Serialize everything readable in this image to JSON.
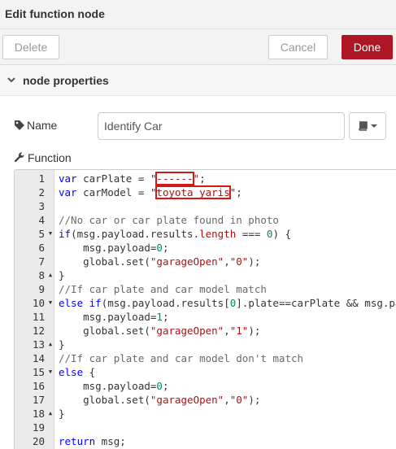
{
  "dialog": {
    "title": "Edit function node"
  },
  "toolbar": {
    "delete_label": "Delete",
    "cancel_label": "Cancel",
    "done_label": "Done"
  },
  "section": {
    "label": "node properties"
  },
  "name_field": {
    "label": "Name",
    "value": "Identify Car"
  },
  "function_field": {
    "label": "Function"
  },
  "colors": {
    "accent": "#ad1625",
    "highlight_box": "#d51717",
    "keyword": "#0000ff",
    "string": "#a31515",
    "number": "#09885a"
  },
  "icons": [
    "chevron-down-icon",
    "tag-icon",
    "book-icon",
    "caret-down-icon",
    "wrench-icon"
  ],
  "code_lines": [
    {
      "n": "1",
      "fold": "",
      "tokens": [
        [
          "kw",
          "var"
        ],
        [
          "",
          " carPlate = "
        ],
        [
          "str",
          "\""
        ],
        [
          "str hl",
          "------"
        ],
        [
          "str",
          "\""
        ],
        [
          "",
          ";"
        ]
      ]
    },
    {
      "n": "2",
      "fold": "",
      "tokens": [
        [
          "kw",
          "var"
        ],
        [
          "",
          " carModel = "
        ],
        [
          "str",
          "\""
        ],
        [
          "str hl",
          "toyota_yaris"
        ],
        [
          "str",
          "\""
        ],
        [
          "",
          ";"
        ]
      ]
    },
    {
      "n": "3",
      "fold": "",
      "tokens": []
    },
    {
      "n": "4",
      "fold": "",
      "tokens": [
        [
          "com",
          "//No car or car plate found in photo"
        ]
      ]
    },
    {
      "n": "5",
      "fold": "▼",
      "tokens": [
        [
          "kw",
          "if"
        ],
        [
          "",
          "(msg.payload.results."
        ],
        [
          "prop",
          "length"
        ],
        [
          "",
          " === "
        ],
        [
          "num",
          "0"
        ],
        [
          "",
          ") {"
        ]
      ]
    },
    {
      "n": "6",
      "fold": "",
      "tokens": [
        [
          "",
          "    msg.payload="
        ],
        [
          "num",
          "0"
        ],
        [
          "",
          ";"
        ]
      ]
    },
    {
      "n": "7",
      "fold": "",
      "tokens": [
        [
          "",
          "    global.set("
        ],
        [
          "str",
          "\"garageOpen\""
        ],
        [
          "",
          ","
        ],
        [
          "str",
          "\"0\""
        ],
        [
          "",
          ");"
        ]
      ]
    },
    {
      "n": "8",
      "fold": "▲",
      "tokens": [
        [
          "",
          "}"
        ]
      ]
    },
    {
      "n": "9",
      "fold": "",
      "tokens": [
        [
          "com",
          "//If car plate and car model match"
        ]
      ]
    },
    {
      "n": "10",
      "fold": "▼",
      "tokens": [
        [
          "kw",
          "else if"
        ],
        [
          "",
          "(msg.payload.results["
        ],
        [
          "num",
          "0"
        ],
        [
          "",
          "].plate==carPlate && msg.payload.re"
        ]
      ]
    },
    {
      "n": "11",
      "fold": "",
      "tokens": [
        [
          "",
          "    msg.payload="
        ],
        [
          "num",
          "1"
        ],
        [
          "",
          ";"
        ]
      ]
    },
    {
      "n": "12",
      "fold": "",
      "tokens": [
        [
          "",
          "    global.set("
        ],
        [
          "str",
          "\"garageOpen\""
        ],
        [
          "",
          ","
        ],
        [
          "str",
          "\"1\""
        ],
        [
          "",
          ");"
        ]
      ]
    },
    {
      "n": "13",
      "fold": "▲",
      "tokens": [
        [
          "",
          "}"
        ]
      ]
    },
    {
      "n": "14",
      "fold": "",
      "tokens": [
        [
          "com",
          "//If car plate and car model don't match"
        ]
      ]
    },
    {
      "n": "15",
      "fold": "▼",
      "tokens": [
        [
          "kw",
          "else"
        ],
        [
          "",
          " {"
        ]
      ]
    },
    {
      "n": "16",
      "fold": "",
      "tokens": [
        [
          "",
          "    msg.payload="
        ],
        [
          "num",
          "0"
        ],
        [
          "",
          ";"
        ]
      ]
    },
    {
      "n": "17",
      "fold": "",
      "tokens": [
        [
          "",
          "    global.set("
        ],
        [
          "str",
          "\"garageOpen\""
        ],
        [
          "",
          ","
        ],
        [
          "str",
          "\"0\""
        ],
        [
          "",
          ");"
        ]
      ]
    },
    {
      "n": "18",
      "fold": "▲",
      "tokens": [
        [
          "",
          "}"
        ]
      ]
    },
    {
      "n": "19",
      "fold": "",
      "tokens": []
    },
    {
      "n": "20",
      "fold": "",
      "tokens": [
        [
          "kw",
          "return"
        ],
        [
          "",
          " msg;"
        ]
      ]
    }
  ]
}
